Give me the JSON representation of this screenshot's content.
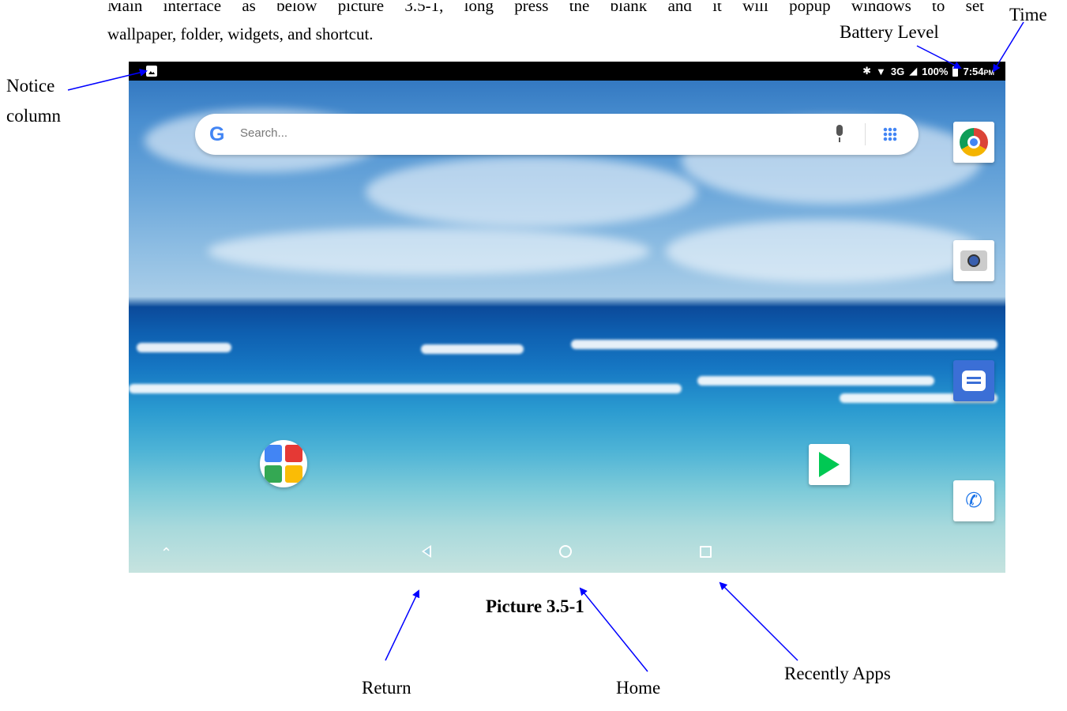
{
  "document": {
    "intro_line1": "Main interface as below picture 3.5-1, long press the blank and it will popup windows to set",
    "intro_line2": "wallpaper, folder, widgets, and shortcut.",
    "caption": "Picture 3.5-1"
  },
  "annotations": {
    "time": "Time",
    "battery_level": "Battery Level",
    "notice_line1": "Notice",
    "notice_line2": "column",
    "return": "Return",
    "home": "Home",
    "recently_apps": "Recently Apps"
  },
  "status_bar": {
    "network": "3G",
    "battery": "100%",
    "time": "7:54",
    "ampm": "PM"
  },
  "search": {
    "placeholder": "Search..."
  },
  "icons": {
    "notice": "image-notification-icon",
    "bluetooth": "bluetooth-icon",
    "wifi": "wifi-icon",
    "signal": "signal-icon",
    "battery": "battery-icon",
    "search_logo": "google-icon",
    "mic": "mic-icon",
    "apps": "app-drawer-icon",
    "dock": [
      "chrome-icon",
      "camera-icon",
      "messages-icon",
      "phone-icon"
    ],
    "play_store": "play-store-icon",
    "folder": "google-apps-folder-icon",
    "nav": [
      "chevron-up-icon",
      "back-icon",
      "home-icon",
      "recent-apps-icon"
    ]
  },
  "colors": {
    "arrow": "#0000ff",
    "status_bar": "#000000"
  }
}
